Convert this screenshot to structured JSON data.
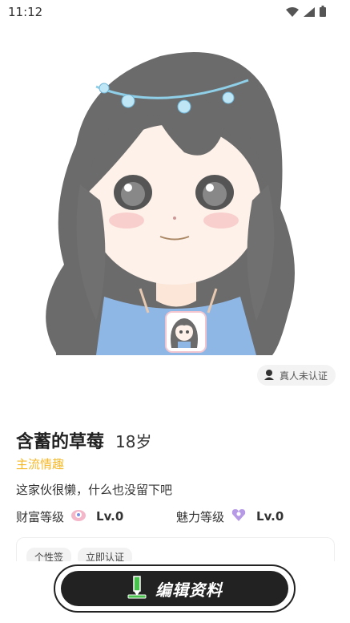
{
  "status_bar": {
    "time": "11:12",
    "icons": [
      "wifi-icon",
      "signal-icon",
      "battery-icon"
    ]
  },
  "profile": {
    "name": "含蓄的草莓",
    "age": "18岁",
    "tag": "主流情趣",
    "bio": "这家伙很懒，什么也没留下吧",
    "verify_label": "真人未认证"
  },
  "levels": [
    {
      "label": "财富等级",
      "value": "Lv.0",
      "icon": "wealth-level-icon"
    },
    {
      "label": "魅力等级",
      "value": "Lv.0",
      "icon": "charm-level-icon"
    }
  ],
  "card": {
    "chips": [
      "个性签",
      "立即认证"
    ]
  },
  "edit_button": {
    "label": "编辑资料"
  },
  "colors": {
    "tag": "#f5b82b",
    "button_bg": "#222222",
    "badge_bg": "#f3f3f3"
  }
}
